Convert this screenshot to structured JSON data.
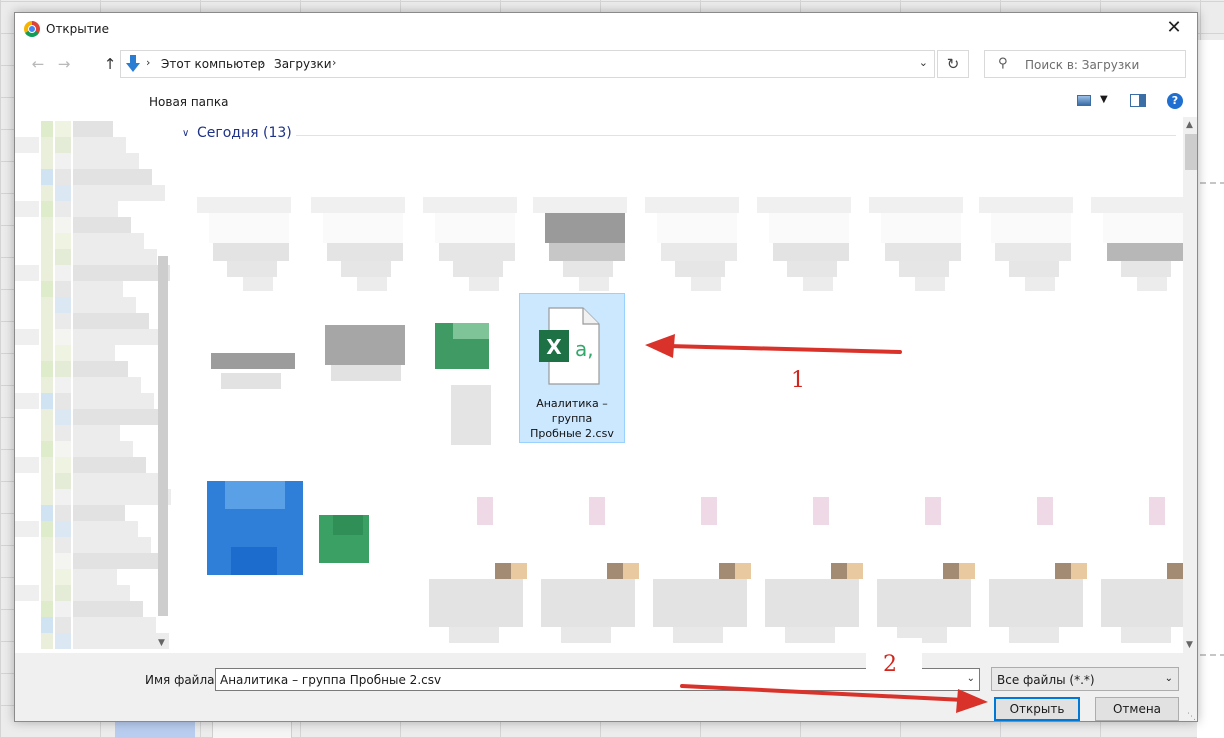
{
  "window": {
    "title": "Открытие",
    "close_symbol": "✕"
  },
  "navigation": {
    "back_symbol": "←",
    "forward_symbol": "→",
    "up_symbol": "↑",
    "breadcrumb": [
      "Этот компьютер",
      "Загрузки"
    ],
    "breadcrumb_sep": "›",
    "refresh_symbol": "↻",
    "search_placeholder": "Поиск в: Загрузки"
  },
  "toolbar": {
    "new_folder_label": "Новая папка"
  },
  "content": {
    "group_header": "Сегодня (13)",
    "group_chevron": "∨",
    "selected_file": {
      "name_lines": [
        "Аналитика –",
        "группа",
        "Пробные 2.csv"
      ],
      "icon": "excel-csv-icon"
    }
  },
  "bottom": {
    "filename_label": "Имя файла:",
    "filename_value": "Аналитика – группа Пробные 2.csv",
    "filetype_value": "Все файлы (*.*)",
    "open_label": "Открыть",
    "cancel_label": "Отмена"
  },
  "annotations": {
    "step1": "1",
    "step2": "2",
    "color": "#d0261e"
  },
  "colors": {
    "selection_bg": "#cce8ff",
    "accent": "#0078d7",
    "excel_green": "#1e7145"
  }
}
